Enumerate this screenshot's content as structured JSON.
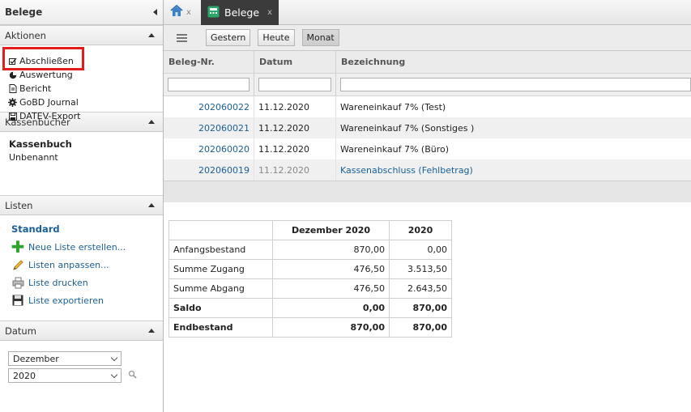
{
  "sidebar": {
    "title": "Belege",
    "aktionen": {
      "header": "Aktionen",
      "items": [
        {
          "label": "Abschließen",
          "icon": "checkbox-edit-icon"
        },
        {
          "label": "Auswertung",
          "icon": "pie-chart-icon"
        },
        {
          "label": "Bericht",
          "icon": "document-icon"
        },
        {
          "label": "GoBD Journal",
          "icon": "gear-icon"
        },
        {
          "label": "DATEV-Export",
          "icon": "save-icon"
        }
      ]
    },
    "kassenbuecher": {
      "header": "Kassenbücher",
      "group": "Kassenbuch",
      "item": "Unbenannt"
    },
    "listen": {
      "header": "Listen",
      "standard": "Standard",
      "items": [
        {
          "label": "Neue Liste erstellen...",
          "icon": "plus-icon"
        },
        {
          "label": "Listen anpassen...",
          "icon": "pencil-icon"
        },
        {
          "label": "Liste drucken",
          "icon": "printer-icon"
        },
        {
          "label": "Liste exportieren",
          "icon": "floppy-icon"
        }
      ]
    },
    "datum": {
      "header": "Datum",
      "month": "Dezember",
      "year": "2020"
    }
  },
  "tabs": {
    "active_label": "Belege",
    "close": "x"
  },
  "toolbar": {
    "buttons": [
      "Gestern",
      "Heute",
      "Monat"
    ],
    "active": "Monat"
  },
  "grid": {
    "columns": [
      "Beleg-Nr.",
      "Datum",
      "Bezeichnung"
    ],
    "rows": [
      {
        "nr": "202060022",
        "datum": "11.12.2020",
        "bez": "Wareneinkauf 7% (Test)"
      },
      {
        "nr": "202060021",
        "datum": "11.12.2020",
        "bez": "Wareneinkauf 7% (Sonstiges )"
      },
      {
        "nr": "202060020",
        "datum": "11.12.2020",
        "bez": "Wareneinkauf 7% (Büro)"
      },
      {
        "nr": "202060019",
        "datum": "11.12.2020",
        "bez": "Kassenabschluss (Fehlbetrag)"
      }
    ]
  },
  "summary": {
    "headers": [
      "",
      "Dezember 2020",
      "2020"
    ],
    "rows": [
      {
        "label": "Anfangsbestand",
        "month": "870,00",
        "year": "0,00"
      },
      {
        "label": "Summe Zugang",
        "month": "476,50",
        "year": "3.513,50"
      },
      {
        "label": "Summe Abgang",
        "month": "476,50",
        "year": "2.643,50"
      },
      {
        "label": "Saldo",
        "month": "0,00",
        "year": "870,00"
      },
      {
        "label": "Endbestand",
        "month": "870,00",
        "year": "870,00"
      }
    ]
  },
  "colors": {
    "accent": "#1a5f9a",
    "highlight": "#e21d1d",
    "tab_active_bg": "#3b3b3b"
  }
}
